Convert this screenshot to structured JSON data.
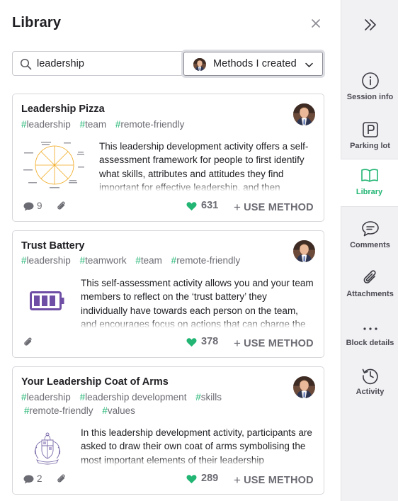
{
  "panel": {
    "title": "Library"
  },
  "search": {
    "value": "leadership"
  },
  "filter": {
    "label": "Methods I created"
  },
  "colors": {
    "accent": "#22b573",
    "battery": "#6f4ea5"
  },
  "cards": [
    {
      "title": "Leadership Pizza",
      "tags": [
        "leadership",
        "team",
        "remote-friendly"
      ],
      "description": "This leadership development activity offers a self-assessment framework for people to first identify what skills, attributes and attitudes they find important for effective leadership, and then",
      "thumbnail": "pizza-diagram",
      "comments": "9",
      "likes": "631",
      "use_label": "USE METHOD"
    },
    {
      "title": "Trust Battery",
      "tags": [
        "leadership",
        "teamwork",
        "team",
        "remote-friendly"
      ],
      "description": "This self-assessment activity allows you and your team members to reflect on the ‘trust battery’ they individually have towards each person on the team, and encourages focus on actions that can charge the",
      "thumbnail": "battery-icon",
      "likes": "378",
      "use_label": "USE METHOD"
    },
    {
      "title": "Your Leadership Coat of Arms",
      "tags": [
        "leadership",
        "leadership development",
        "skills",
        "remote-friendly",
        "values"
      ],
      "description": "In this leadership development activity, participants are asked to draw their own coat of arms symbolising the most important elements of their leadership",
      "thumbnail": "coat-of-arms",
      "comments": "2",
      "likes": "289",
      "use_label": "USE METHOD"
    }
  ],
  "sidebar": {
    "items": [
      {
        "label": "Session info",
        "icon": "info-icon"
      },
      {
        "label": "Parking lot",
        "icon": "parking-icon"
      },
      {
        "label": "Library",
        "icon": "book-icon",
        "active": true
      },
      {
        "label": "Comments",
        "icon": "chat-icon"
      },
      {
        "label": "Attachments",
        "icon": "paperclip-icon"
      },
      {
        "label": "Block details",
        "icon": "more-dots-icon"
      },
      {
        "label": "Activity",
        "icon": "history-icon"
      }
    ]
  }
}
